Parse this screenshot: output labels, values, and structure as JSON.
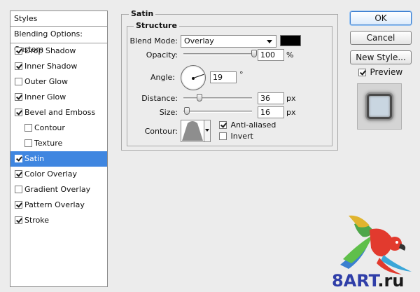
{
  "styles_panel": {
    "header": "Styles",
    "blending_options": "Blending Options: Custom",
    "items": [
      {
        "label": "Drop Shadow",
        "checked": true,
        "indent": false
      },
      {
        "label": "Inner Shadow",
        "checked": true,
        "indent": false
      },
      {
        "label": "Outer Glow",
        "checked": false,
        "indent": false
      },
      {
        "label": "Inner Glow",
        "checked": true,
        "indent": false
      },
      {
        "label": "Bevel and Emboss",
        "checked": true,
        "indent": false
      },
      {
        "label": "Contour",
        "checked": false,
        "indent": true
      },
      {
        "label": "Texture",
        "checked": false,
        "indent": true
      },
      {
        "label": "Satin",
        "checked": true,
        "indent": false,
        "selected": true
      },
      {
        "label": "Color Overlay",
        "checked": true,
        "indent": false
      },
      {
        "label": "Gradient Overlay",
        "checked": false,
        "indent": false
      },
      {
        "label": "Pattern Overlay",
        "checked": true,
        "indent": false
      },
      {
        "label": "Stroke",
        "checked": true,
        "indent": false
      }
    ]
  },
  "satin": {
    "title": "Satin",
    "structure_title": "Structure",
    "blend_mode": {
      "label": "Blend Mode:",
      "value": "Overlay",
      "color": "#000000"
    },
    "opacity": {
      "label": "Opacity:",
      "value": "100",
      "unit": "%",
      "fraction": 1.0
    },
    "angle": {
      "label": "Angle:",
      "value": "19",
      "unit": "°"
    },
    "distance": {
      "label": "Distance:",
      "value": "36",
      "unit": "px",
      "fraction": 0.24
    },
    "size": {
      "label": "Size:",
      "value": "16",
      "unit": "px",
      "fraction": 0.06
    },
    "contour": {
      "label": "Contour:"
    },
    "anti_aliased": {
      "label": "Anti-aliased",
      "checked": true
    },
    "invert": {
      "label": "Invert",
      "checked": false
    }
  },
  "buttons": {
    "ok": "OK",
    "cancel": "Cancel",
    "new_style": "New Style..."
  },
  "preview": {
    "label": "Preview",
    "checked": true
  },
  "watermark": {
    "brand": "8ART",
    "tld": ".ru"
  },
  "colors": {
    "selection": "#3f86e0",
    "primary_button_border": "#3c7fd0"
  }
}
